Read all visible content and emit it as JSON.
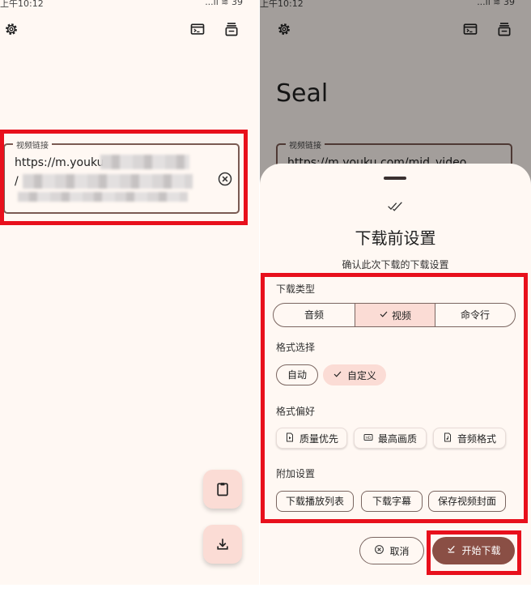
{
  "status_bar": {
    "time": "上午10:12",
    "right": "...ıl ≋ 39"
  },
  "left_screen": {
    "url_field": {
      "label": "视频链接",
      "value_visible": "https://m.youku.c",
      "value_line2_prefix": "/",
      "value_obscured": true
    },
    "icons": [
      "settings-icon",
      "terminal-icon",
      "queue-icon",
      "clear-icon",
      "paste-icon",
      "download-icon"
    ]
  },
  "right_screen": {
    "app_title": "Seal",
    "url_field": {
      "label": "视频链接",
      "value": "https://m.youku.com/mid_video"
    },
    "sheet": {
      "title": "下载前设置",
      "subtitle": "确认此次下载的下载设置",
      "download_type": {
        "label": "下载类型",
        "options": [
          "音频",
          "视频",
          "命令行"
        ],
        "selected": "视频"
      },
      "format_select": {
        "label": "格式选择",
        "options": [
          "自动",
          "自定义"
        ],
        "selected": "自定义"
      },
      "format_pref": {
        "label": "格式偏好",
        "options": [
          "质量优先",
          "最高画质",
          "音频格式"
        ]
      },
      "extra_settings": {
        "label": "附加设置",
        "options": [
          "下载播放列表",
          "下载字幕",
          "保存视频封面"
        ]
      },
      "cancel_label": "取消",
      "start_label": "开始下载"
    }
  },
  "colors": {
    "highlight": "#e8101c",
    "accent": "#8a4f45",
    "selected_bg": "#fbdcd5",
    "surface": "#fff8f3"
  }
}
